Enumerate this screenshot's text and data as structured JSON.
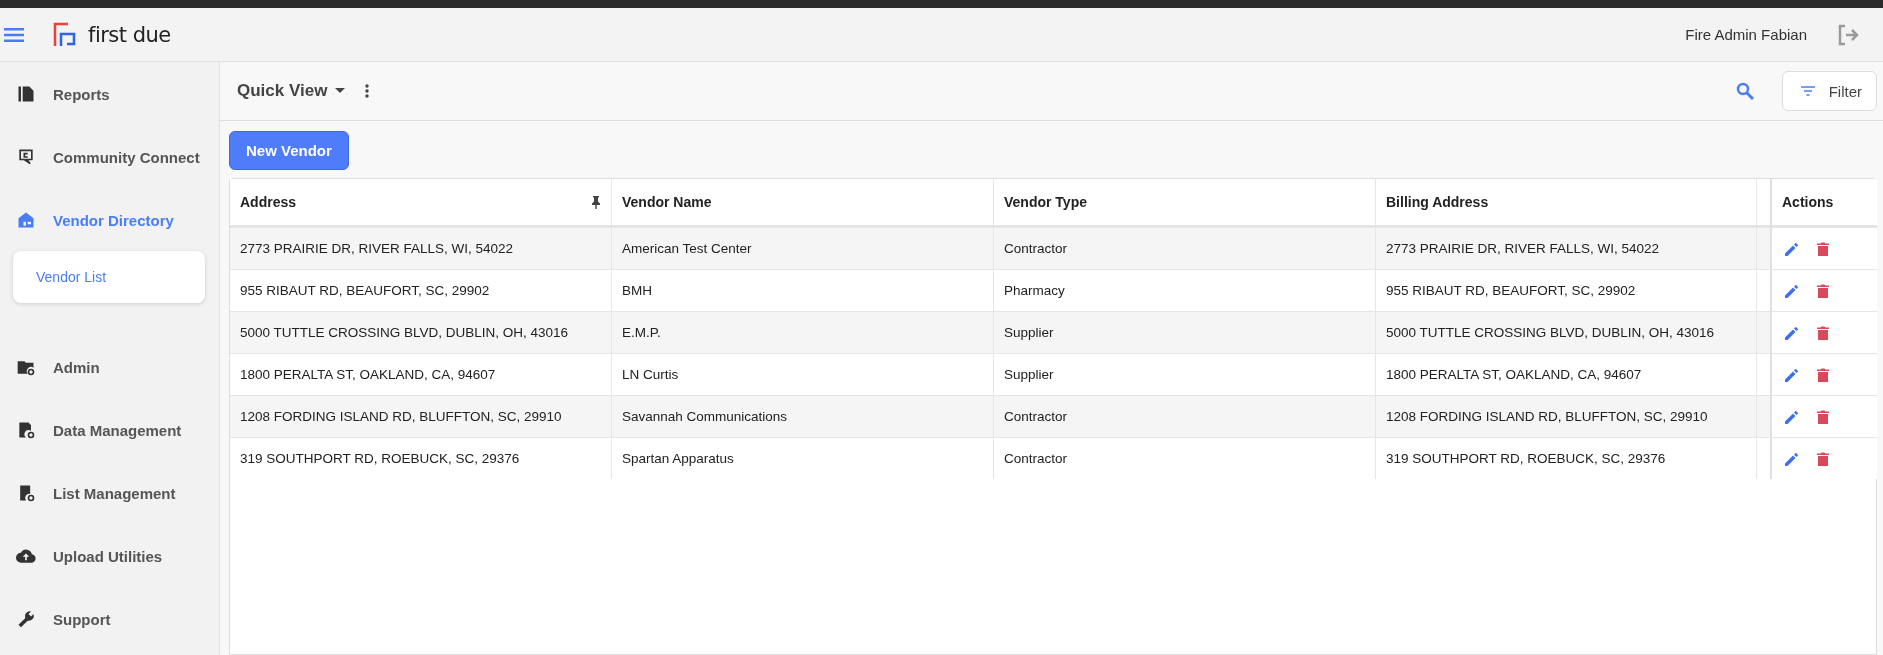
{
  "header": {
    "brand": "first due",
    "user": "Fire Admin Fabian"
  },
  "sidebar": {
    "items": [
      {
        "label": "Reports",
        "selected": false
      },
      {
        "label": "Community Connect",
        "selected": false
      },
      {
        "label": "Vendor Directory",
        "selected": true,
        "children": [
          {
            "label": "Vendor List",
            "selected": true
          }
        ]
      },
      {
        "label": "Admin",
        "selected": false
      },
      {
        "label": "Data Management",
        "selected": false
      },
      {
        "label": "List Management",
        "selected": false
      },
      {
        "label": "Upload Utilities",
        "selected": false
      },
      {
        "label": "Support",
        "selected": false
      }
    ]
  },
  "toolbar": {
    "view": "Quick View",
    "filter": "Filter"
  },
  "new_button": "New Vendor",
  "table": {
    "columns": [
      {
        "label": "Address",
        "pinned": true
      },
      {
        "label": "Vendor Name",
        "pinned": false
      },
      {
        "label": "Vendor Type",
        "pinned": false
      },
      {
        "label": "Billing Address",
        "pinned": false
      }
    ],
    "actions_label": "Actions",
    "rows": [
      {
        "address": "2773 PRAIRIE DR, RIVER FALLS, WI, 54022",
        "vendor_name": "American Test Center",
        "vendor_type": "Contractor",
        "billing_address": "2773 PRAIRIE DR, RIVER FALLS, WI, 54022"
      },
      {
        "address": "955 RIBAUT RD, BEAUFORT, SC, 29902",
        "vendor_name": "BMH",
        "vendor_type": "Pharmacy",
        "billing_address": "955 RIBAUT RD, BEAUFORT, SC, 29902"
      },
      {
        "address": "5000 TUTTLE CROSSING BLVD, DUBLIN, OH, 43016",
        "vendor_name": "E.M.P.",
        "vendor_type": "Supplier",
        "billing_address": "5000 TUTTLE CROSSING BLVD, DUBLIN, OH, 43016"
      },
      {
        "address": "1800 PERALTA ST, OAKLAND, CA, 94607",
        "vendor_name": "LN Curtis",
        "vendor_type": "Supplier",
        "billing_address": "1800 PERALTA ST, OAKLAND, CA, 94607"
      },
      {
        "address": "1208 FORDING ISLAND RD, BLUFFTON, SC, 29910",
        "vendor_name": "Savannah Communications",
        "vendor_type": "Contractor",
        "billing_address": "1208 FORDING ISLAND RD, BLUFFTON, SC, 29910"
      },
      {
        "address": "319 SOUTHPORT RD, ROEBUCK, SC, 29376",
        "vendor_name": "Spartan Apparatus",
        "vendor_type": "Contractor",
        "billing_address": "319 SOUTHPORT RD, ROEBUCK, SC, 29376"
      }
    ]
  }
}
